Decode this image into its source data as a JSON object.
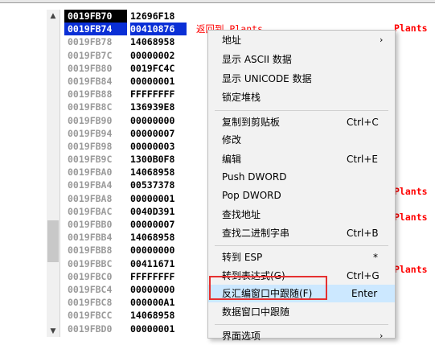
{
  "stack": {
    "rows": [
      {
        "addr": "0019FB70",
        "val": "12696F18",
        "cmt": ""
      },
      {
        "addr": "0019FB74",
        "val": "00410876",
        "cmt": "返回到 Plants"
      },
      {
        "addr": "0019FB78",
        "val": "14068958",
        "cmt": ""
      },
      {
        "addr": "0019FB7C",
        "val": "00000002",
        "cmt": ""
      },
      {
        "addr": "0019FB80",
        "val": "0019FC4C",
        "cmt": ""
      },
      {
        "addr": "0019FB84",
        "val": "00000001",
        "cmt": ""
      },
      {
        "addr": "0019FB88",
        "val": "FFFFFFFF",
        "cmt": ""
      },
      {
        "addr": "0019FB8C",
        "val": "136939E8",
        "cmt": ""
      },
      {
        "addr": "0019FB90",
        "val": "00000000",
        "cmt": ""
      },
      {
        "addr": "0019FB94",
        "val": "00000007",
        "cmt": ""
      },
      {
        "addr": "0019FB98",
        "val": "00000003",
        "cmt": ""
      },
      {
        "addr": "0019FB9C",
        "val": "1300B0F8",
        "cmt": ""
      },
      {
        "addr": "0019FBA0",
        "val": "14068958",
        "cmt": ""
      },
      {
        "addr": "0019FBA4",
        "val": "00537378",
        "cmt": ""
      },
      {
        "addr": "0019FBA8",
        "val": "00000001",
        "cmt": ""
      },
      {
        "addr": "0019FBAC",
        "val": "0040D391",
        "cmt": ""
      },
      {
        "addr": "0019FBB0",
        "val": "00000007",
        "cmt": ""
      },
      {
        "addr": "0019FBB4",
        "val": "14068958",
        "cmt": ""
      },
      {
        "addr": "0019FBB8",
        "val": "00000000",
        "cmt": ""
      },
      {
        "addr": "0019FBBC",
        "val": "00411671",
        "cmt": ""
      },
      {
        "addr": "0019FBC0",
        "val": "FFFFFFFF",
        "cmt": ""
      },
      {
        "addr": "0019FBC4",
        "val": "00000000",
        "cmt": ""
      },
      {
        "addr": "0019FBC8",
        "val": "000000A1",
        "cmt": ""
      },
      {
        "addr": "0019FBCC",
        "val": "14068958",
        "cmt": ""
      },
      {
        "addr": "0019FBD0",
        "val": "00000001",
        "cmt": ""
      }
    ],
    "right_comments": {
      "row1": "Plants",
      "row13": "Plants",
      "row15": "Plants",
      "row19": "Plants"
    },
    "row1_full_comment": "返回到 Plants"
  },
  "menu": {
    "items": [
      {
        "label": "地址",
        "shortcut": "",
        "arrow": "›"
      },
      {
        "label": "显示 ASCII 数据",
        "shortcut": "",
        "arrow": ""
      },
      {
        "label": "显示 UNICODE 数据",
        "shortcut": "",
        "arrow": ""
      },
      {
        "label": "锁定堆栈",
        "shortcut": "",
        "arrow": ""
      },
      {
        "label": "复制到剪贴板",
        "shortcut": "Ctrl+C",
        "arrow": ""
      },
      {
        "label": "修改",
        "shortcut": "",
        "arrow": ""
      },
      {
        "label": "编辑",
        "shortcut": "Ctrl+E",
        "arrow": ""
      },
      {
        "label": "Push DWORD",
        "shortcut": "",
        "arrow": ""
      },
      {
        "label": "Pop DWORD",
        "shortcut": "",
        "arrow": ""
      },
      {
        "label": "查找地址",
        "shortcut": "",
        "arrow": ""
      },
      {
        "label": "查找二进制字串",
        "shortcut": "Ctrl+B",
        "arrow": ""
      },
      {
        "label": "转到 ESP",
        "shortcut": "*",
        "arrow": ""
      },
      {
        "label": "转到表达式(G)",
        "shortcut": "Ctrl+G",
        "arrow": ""
      },
      {
        "label": "反汇编窗口中跟随(F)",
        "shortcut": "Enter",
        "arrow": ""
      },
      {
        "label": "数据窗口中跟随",
        "shortcut": "",
        "arrow": ""
      },
      {
        "label": "界面选项",
        "shortcut": "",
        "arrow": "›"
      }
    ]
  },
  "icons": {
    "scroll_up": "chevron-up-icon",
    "scroll_down": "chevron-down-icon",
    "submenu": "chevron-right-icon"
  },
  "colors": {
    "selection_blue": "#0a2fd6",
    "comment_red": "#ff0000",
    "highlight": "#cce8ff",
    "annotation_red": "#e53030"
  }
}
